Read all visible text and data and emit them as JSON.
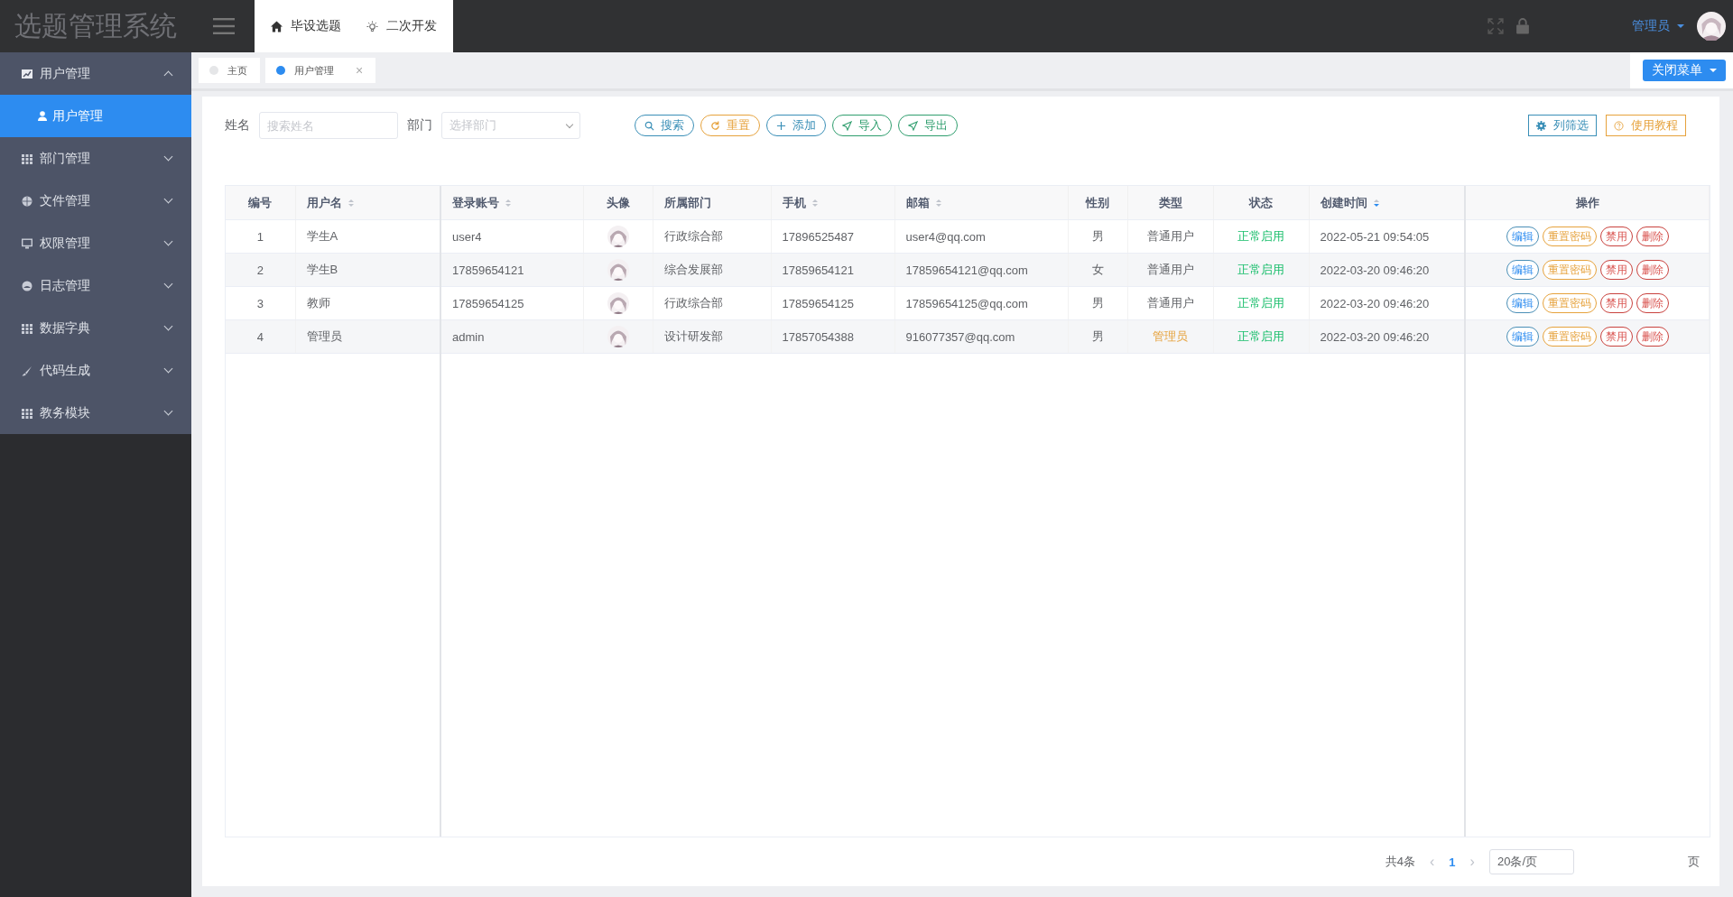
{
  "app_title": "选题管理系统",
  "top_nav": [
    {
      "label": "毕设选题"
    },
    {
      "label": "二次开发"
    }
  ],
  "user": {
    "name": "管理员"
  },
  "sidebar": {
    "items": [
      {
        "label": "用户管理",
        "expanded": true,
        "children": [
          {
            "label": "用户管理",
            "selected": true
          }
        ]
      },
      {
        "label": "部门管理",
        "expanded": false
      },
      {
        "label": "文件管理",
        "expanded": false
      },
      {
        "label": "权限管理",
        "expanded": false
      },
      {
        "label": "日志管理",
        "expanded": false
      },
      {
        "label": "数据字典",
        "expanded": false
      },
      {
        "label": "代码生成",
        "expanded": false
      },
      {
        "label": "教务模块",
        "expanded": false
      }
    ]
  },
  "tabs": [
    {
      "label": "主页",
      "selected": false
    },
    {
      "label": "用户管理",
      "selected": true,
      "close": "×"
    }
  ],
  "close_menu_button": "关闭菜单",
  "filters": [
    {
      "label": "姓名",
      "kind": "input",
      "placeholder": "搜索姓名"
    },
    {
      "label": "部门",
      "kind": "select",
      "placeholder": "选择部门"
    }
  ],
  "actions": [
    {
      "label": "搜索",
      "kind": "info"
    },
    {
      "label": "重置",
      "kind": "warning"
    },
    {
      "label": "添加",
      "kind": "info"
    },
    {
      "label": "导入",
      "kind": "success"
    },
    {
      "label": "导出",
      "kind": "success"
    }
  ],
  "right_actions": [
    {
      "label": "列筛选",
      "kind": "info"
    },
    {
      "label": "使用教程",
      "kind": "warning"
    }
  ],
  "table": {
    "columns": [
      {
        "label": "编号",
        "sortable": false
      },
      {
        "label": "用户名",
        "sortable": true,
        "sorted": false
      },
      {
        "label": "登录账号",
        "sortable": true,
        "sorted": false
      },
      {
        "label": "头像",
        "sortable": false
      },
      {
        "label": "所属部门",
        "sortable": false
      },
      {
        "label": "手机",
        "sortable": true,
        "sorted": false
      },
      {
        "label": "邮箱",
        "sortable": true,
        "sorted": false
      },
      {
        "label": "性别",
        "sortable": false
      },
      {
        "label": "类型",
        "sortable": false
      },
      {
        "label": "状态",
        "sortable": false
      },
      {
        "label": "创建时间",
        "sortable": true,
        "sorted": true
      },
      {
        "label": "操作",
        "sortable": false
      }
    ],
    "rows": [
      {
        "id": "1",
        "username": "学生A",
        "account": "user4",
        "avatar": {
          "kind": "picture"
        },
        "department": "行政综合部",
        "phone": "17896525487",
        "email": "user4@qq.com",
        "gender": "男",
        "type": {
          "text": "普通用户",
          "kind": "user"
        },
        "status": "正常启用",
        "created": "2022-05-21 09:54:05",
        "ops": [
          {
            "label": "编辑",
            "kind": "primary"
          },
          {
            "label": "重置密码",
            "kind": "warning"
          },
          {
            "label": "禁用",
            "kind": "danger"
          },
          {
            "label": "删除",
            "kind": "danger"
          }
        ]
      },
      {
        "id": "2",
        "username": "学生B",
        "account": "17859654121",
        "avatar": {
          "kind": "picture"
        },
        "department": "综合发展部",
        "phone": "17859654121",
        "email": "17859654121@qq.com",
        "gender": "女",
        "type": {
          "text": "普通用户",
          "kind": "user"
        },
        "status": "正常启用",
        "created": "2022-03-20 09:46:20",
        "ops": [
          {
            "label": "编辑",
            "kind": "primary"
          },
          {
            "label": "重置密码",
            "kind": "warning"
          },
          {
            "label": "禁用",
            "kind": "danger"
          },
          {
            "label": "删除",
            "kind": "danger"
          }
        ]
      },
      {
        "id": "3",
        "username": "教师",
        "account": "17859654125",
        "avatar": {
          "kind": "picture"
        },
        "department": "行政综合部",
        "phone": "17859654125",
        "email": "17859654125@qq.com",
        "gender": "男",
        "type": {
          "text": "普通用户",
          "kind": "user"
        },
        "status": "正常启用",
        "created": "2022-03-20 09:46:20",
        "ops": [
          {
            "label": "编辑",
            "kind": "primary"
          },
          {
            "label": "重置密码",
            "kind": "warning"
          },
          {
            "label": "禁用",
            "kind": "danger"
          },
          {
            "label": "删除",
            "kind": "danger"
          }
        ]
      },
      {
        "id": "4",
        "username": "管理员",
        "account": "admin",
        "avatar": {
          "kind": "picture"
        },
        "department": "设计研发部",
        "phone": "17857054388",
        "email": "916077357@qq.com",
        "gender": "男",
        "type": {
          "text": "管理员",
          "kind": "admin"
        },
        "status": "正常启用",
        "created": "2022-03-20 09:46:20",
        "ops": [
          {
            "label": "编辑",
            "kind": "primary"
          },
          {
            "label": "重置密码",
            "kind": "warning"
          },
          {
            "label": "禁用",
            "kind": "danger"
          },
          {
            "label": "删除",
            "kind": "danger"
          }
        ]
      }
    ]
  },
  "pagination": {
    "total": "共4条",
    "prev": "‹",
    "pages": [
      {
        "label": "1",
        "selected": true
      }
    ],
    "next": "›",
    "page_size": "20条/页",
    "suffix": "页"
  }
}
